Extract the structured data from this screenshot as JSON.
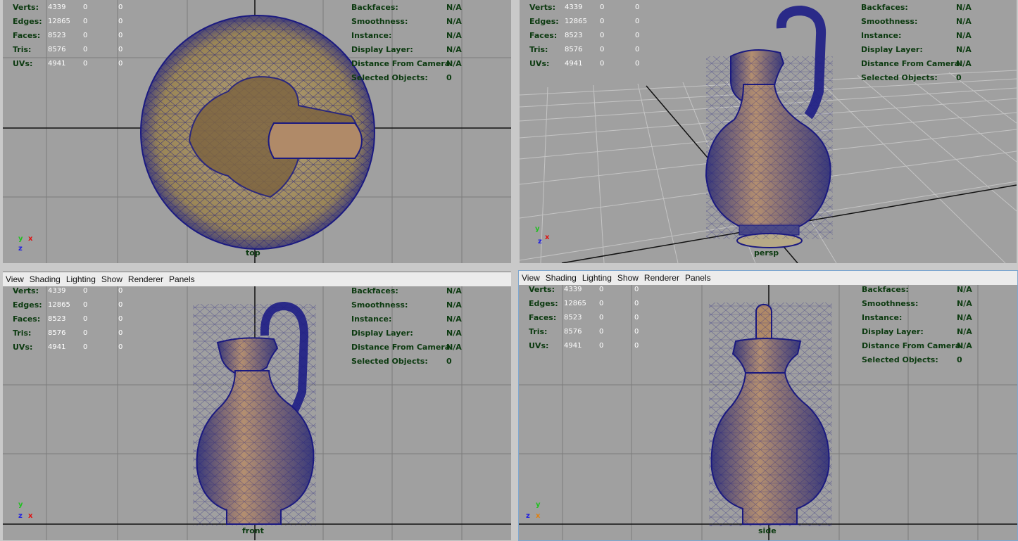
{
  "menu": [
    "View",
    "Shading",
    "Lighting",
    "Show",
    "Renderer",
    "Panels"
  ],
  "stats": {
    "labels": [
      "Verts:",
      "Edges:",
      "Faces:",
      "Tris:",
      "UVs:"
    ],
    "values": [
      [
        "4339",
        "0",
        "0"
      ],
      [
        "12865",
        "0",
        "0"
      ],
      [
        "8523",
        "0",
        "0"
      ],
      [
        "8576",
        "0",
        "0"
      ],
      [
        "4941",
        "0",
        "0"
      ]
    ]
  },
  "info": {
    "labels": [
      "Backfaces:",
      "Smoothness:",
      "Instance:",
      "Display Layer:",
      "Distance From Camera:",
      "Selected Objects:"
    ],
    "values": [
      "N/A",
      "N/A",
      "N/A",
      "N/A",
      "N/A",
      "0"
    ]
  },
  "cameras": {
    "top": "top",
    "persp": "persp",
    "front": "front",
    "side": "side"
  },
  "colors": {
    "viewport_bg": "#a0a0a0",
    "grid": "#7c7c7c",
    "axis_line": "#111111",
    "wire": "#1b1a80",
    "mesh_fill": "#9c8450"
  },
  "axis": {
    "x": "x",
    "y": "y",
    "z": "z"
  }
}
